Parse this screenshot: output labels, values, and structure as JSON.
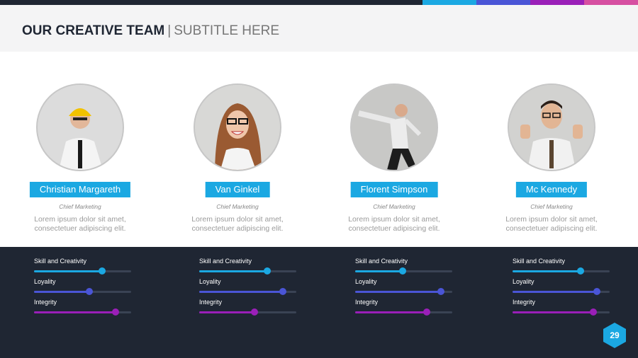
{
  "header": {
    "title": "OUR CREATIVE TEAM",
    "separator": "|",
    "subtitle": "SUBTITLE HERE"
  },
  "colors": {
    "accent_blue": "#1ba8e2",
    "indigo": "#4a55d6",
    "purple": "#9a1fb8",
    "dark_bg": "#1f2633",
    "topbar_stripe": [
      "#1ba8e2",
      "#4a55d6",
      "#9a1fb8",
      "#d64fa1"
    ]
  },
  "team": [
    {
      "name": "Christian Margareth",
      "role": "Chief Marketing",
      "desc1": "Lorem ipsum dolor sit amet,",
      "desc2": "consectetuer adipiscing elit.",
      "avatar_icon": "person-hardhat-photo",
      "skills": [
        {
          "label": "Skill and Creativity",
          "value": 0.7
        },
        {
          "label": "Loyality",
          "value": 0.57
        },
        {
          "label": "Integrity",
          "value": 0.84
        }
      ]
    },
    {
      "name": "Van Ginkel",
      "role": "Chief Marketing",
      "desc1": "Lorem ipsum dolor sit amet,",
      "desc2": "consectetuer adipiscing elit.",
      "avatar_icon": "person-woman-glasses-photo",
      "skills": [
        {
          "label": "Skill and Creativity",
          "value": 0.7
        },
        {
          "label": "Loyality",
          "value": 0.86
        },
        {
          "label": "Integrity",
          "value": 0.57
        }
      ]
    },
    {
      "name": "Florent Simpson",
      "role": "Chief Marketing",
      "desc1": "Lorem ipsum dolor sit amet,",
      "desc2": "consectetuer adipiscing elit.",
      "avatar_icon": "person-running-photo",
      "skills": [
        {
          "label": "Skill and Creativity",
          "value": 0.49
        },
        {
          "label": "Loyality",
          "value": 0.88
        },
        {
          "label": "Integrity",
          "value": 0.74
        }
      ]
    },
    {
      "name": "Mc Kennedy",
      "role": "Chief Marketing",
      "desc1": "Lorem ipsum dolor sit amet,",
      "desc2": "consectetuer adipiscing elit.",
      "avatar_icon": "person-thumbsup-photo",
      "skills": [
        {
          "label": "Skill and Creativity",
          "value": 0.7
        },
        {
          "label": "Loyality",
          "value": 0.87
        },
        {
          "label": "Integrity",
          "value": 0.83
        }
      ]
    }
  ],
  "page_number": "29"
}
